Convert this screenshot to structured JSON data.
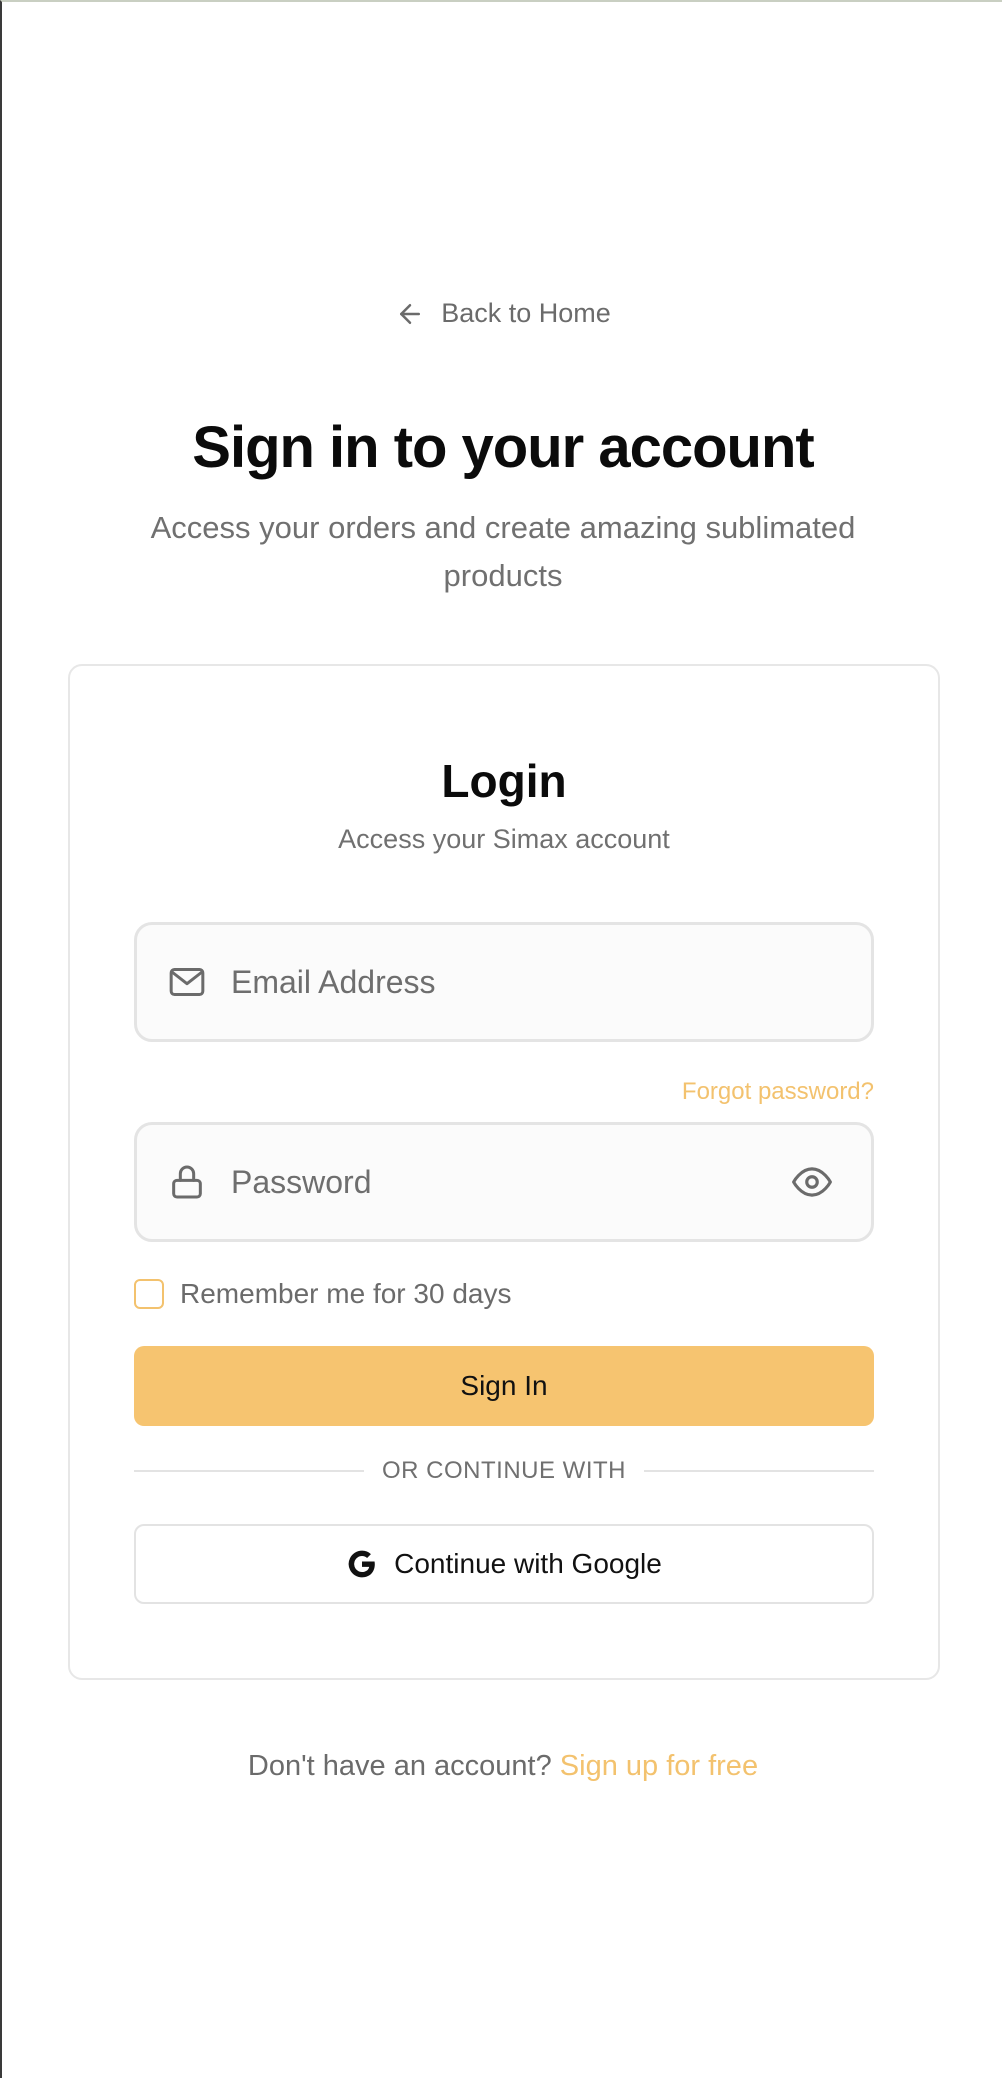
{
  "nav": {
    "back_label": "Back to Home"
  },
  "hero": {
    "title": "Sign in to your account",
    "subtitle": "Access your orders and create amazing sublimated products"
  },
  "login_card": {
    "title": "Login",
    "subtitle": "Access your Simax account",
    "email": {
      "placeholder": "Email Address",
      "value": "",
      "icon": "mail-icon"
    },
    "password": {
      "placeholder": "Password",
      "value": "",
      "icon": "lock-icon",
      "toggle_icon": "eye-icon"
    },
    "forgot_password_label": "Forgot password?",
    "remember_me": {
      "label": "Remember me for 30 days",
      "checked": false
    },
    "sign_in_label": "Sign In",
    "divider_label": "OR CONTINUE WITH",
    "google_button_label": "Continue with Google"
  },
  "footer": {
    "prompt": "Don't have an account?",
    "signup_label": "Sign up for free"
  },
  "colors": {
    "accent": "#f6c470",
    "accent_text": "#f3c26e",
    "muted_text": "#6b6b6b",
    "border": "#e4e4e4"
  }
}
